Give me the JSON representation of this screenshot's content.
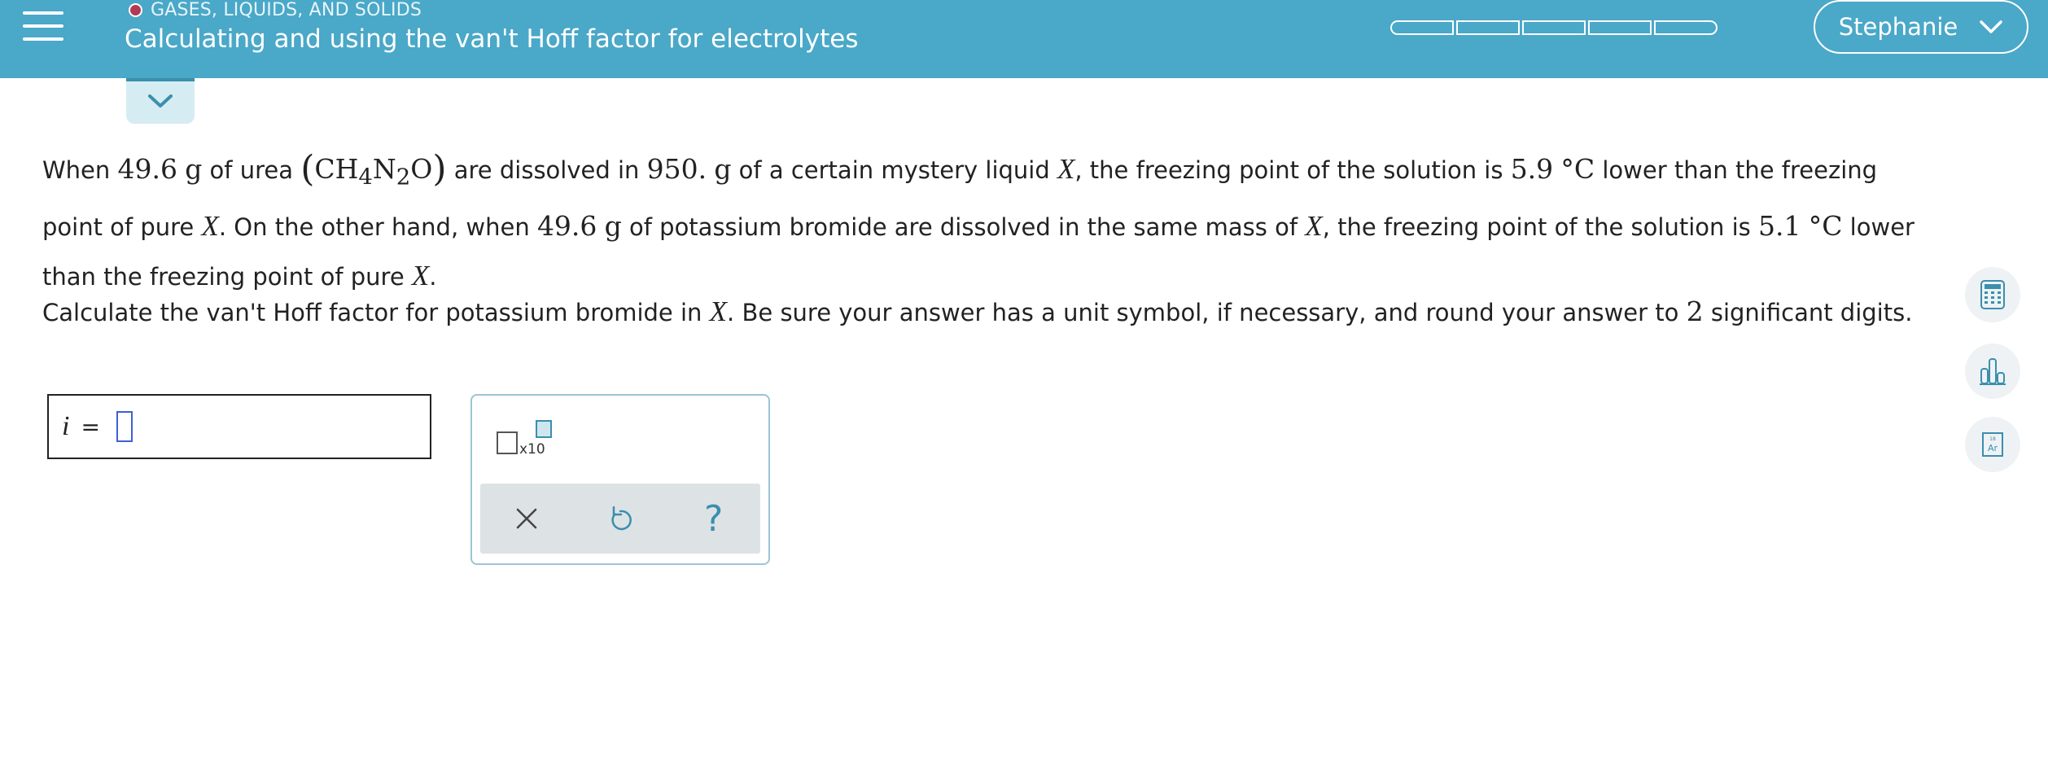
{
  "header": {
    "category": "GASES, LIQUIDS, AND SOLIDS",
    "title": "Calculating and using the van't Hoff factor for electrolytes",
    "progress_segments": 5,
    "progress_filled": 0,
    "user_name": "Stephanie",
    "category_dot_color": "#b23a55",
    "bar_color": "#4aa8c8"
  },
  "problem": {
    "t01": "When ",
    "v_mass_urea": "49.6",
    "u_g1": "g",
    "t02": " of urea ",
    "paren_open": "(",
    "ch": "CH",
    "sub4": "4",
    "n": "N",
    "sub2": "2",
    "o": "O",
    "paren_close": ")",
    "t03": " are dissolved in ",
    "v_mass_liquid": "950.",
    "u_g2": "g",
    "t04": " of a certain mystery liquid ",
    "x1": "X",
    "t05": ", the freezing point of the solution is ",
    "v_dt1": "5.9",
    "u_c1": "°C",
    "t06": " lower than the freezing point of pure ",
    "x2": "X",
    "t07": ". On the other hand, when ",
    "v_mass_kbr": "49.6",
    "u_g3": "g",
    "t08": " of potassium bromide are dissolved in the same mass of ",
    "x3": "X",
    "t09": ", the freezing point of the solution is ",
    "v_dt2": "5.1",
    "u_c2": "°C",
    "t10": " lower than the freezing point of pure ",
    "x4": "X",
    "t11": "."
  },
  "prompt": {
    "p1": "Calculate the van't Hoff factor for potassium bromide in ",
    "x": "X",
    "p2": ". Be sure your answer has a unit symbol, if necessary, and round your answer to ",
    "digits": "2",
    "p3": " significant digits."
  },
  "answer": {
    "variable": "i",
    "equals": "=",
    "value": ""
  },
  "palette": {
    "sci_label": "x10",
    "clear_icon": "x-icon",
    "undo_icon": "undo-icon",
    "help_label": "?"
  },
  "side_tools": [
    "calculator-icon",
    "bar-chart-icon",
    "periodic-table-icon"
  ],
  "periodic": {
    "number": "18",
    "symbol": "Ar"
  }
}
